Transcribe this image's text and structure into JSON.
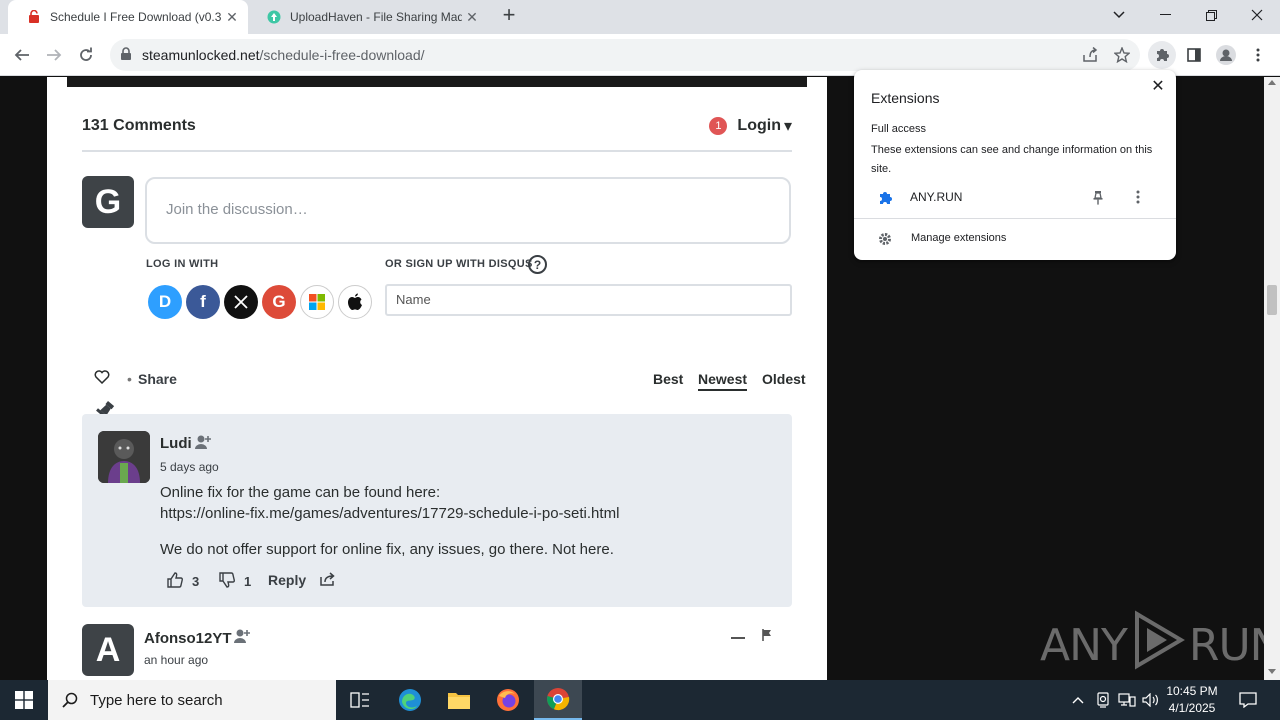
{
  "browser": {
    "tabs": [
      {
        "title": "Schedule I Free Download (v0.3.3",
        "active": true
      },
      {
        "title": "UploadHaven - File Sharing Mad",
        "active": false
      }
    ],
    "url_domain": "steamunlocked.net",
    "url_path": "/schedule-i-free-download/"
  },
  "comments": {
    "count_label": "131 Comments",
    "notification_count": "1",
    "login_label": "Login",
    "login_arrow": "▾",
    "guest_initial": "G",
    "compose_placeholder": "Join the discussion…",
    "log_in_with": "LOG IN WITH",
    "sign_up_with": "OR SIGN UP WITH DISQUS",
    "help": "?",
    "name_placeholder": "Name",
    "share_label": "Share",
    "sort_options": [
      "Best",
      "Newest",
      "Oldest"
    ],
    "sort_selected": "Newest",
    "pinned_comment": {
      "author": "Ludi",
      "time": "5 days ago",
      "lines": [
        "Online fix for the game can be found here:",
        "https://online-fix.me/games/adventures/17729-schedule-i-po-seti.html",
        "We do not offer support for online fix, any issues, go there. Not here."
      ],
      "upvotes": "3",
      "downvotes": "1",
      "reply_label": "Reply"
    },
    "second_comment": {
      "initial": "A",
      "author": "Afonso12YT",
      "time": "an hour ago"
    }
  },
  "extensions_popup": {
    "title": "Extensions",
    "section": "Full access",
    "description": "These extensions can see and change information on this site.",
    "extension_name": "ANY.RUN",
    "manage_label": "Manage extensions"
  },
  "watermark": {
    "text_left": "ANY",
    "text_right": "RUN"
  },
  "taskbar": {
    "search_placeholder": "Type here to search",
    "time": "10:45 PM",
    "date": "4/1/2025"
  },
  "colors": {
    "accent_red": "#e05555",
    "card_bg": "#e8ecf1",
    "taskbar_bg": "#1c2833"
  }
}
